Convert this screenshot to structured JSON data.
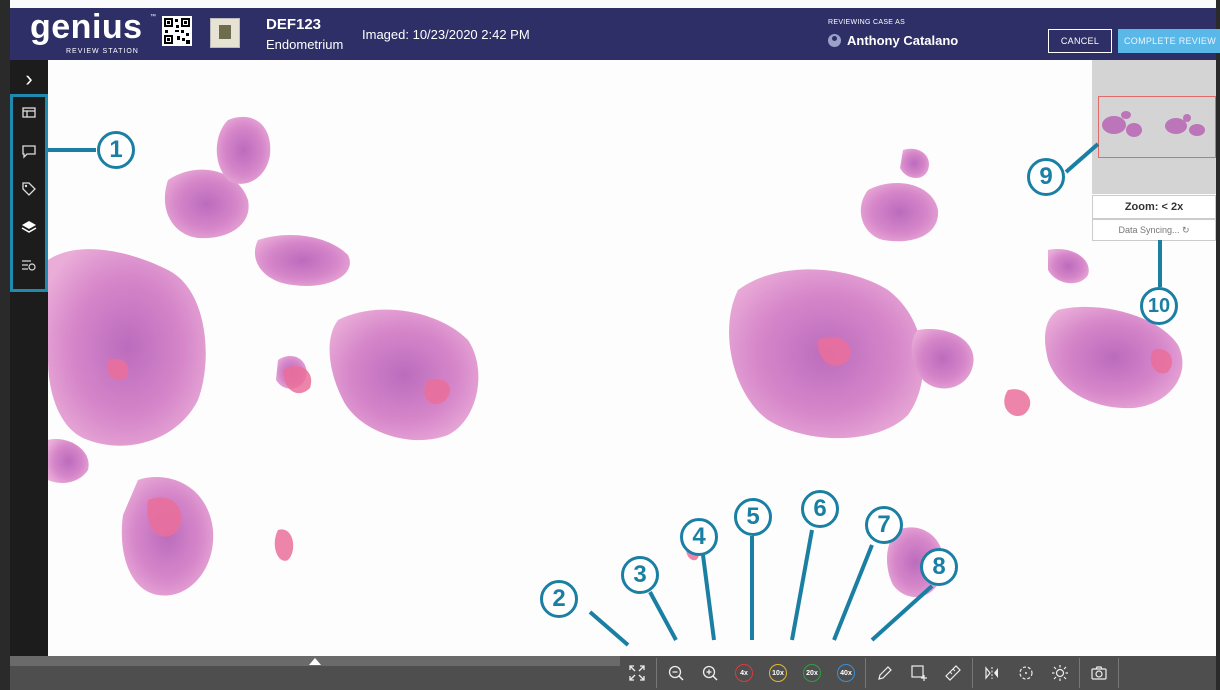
{
  "header": {
    "logo_word": "genius",
    "logo_tm": "™",
    "logo_sub": "REVIEW STATION",
    "case_id": "DEF123",
    "case_type": "Endometrium",
    "imaged": "Imaged: 10/23/2020 2:42 PM",
    "reviewing_label": "REVIEWING CASE AS",
    "reviewer_name": "Anthony Catalano",
    "cancel_label": "CANCEL",
    "complete_label": "COMPLETE REVIEW"
  },
  "sidebar": {
    "toggle_icon": "chevron-right-icon",
    "items": [
      {
        "icon": "slides-icon"
      },
      {
        "icon": "comment-icon"
      },
      {
        "icon": "tag-icon"
      },
      {
        "icon": "layers-icon"
      },
      {
        "icon": "filter-list-icon"
      }
    ]
  },
  "minimap": {
    "zoom_text": "Zoom: < 2x",
    "sync_text": "Data Syncing..."
  },
  "toolbar": {
    "mag_4x": "4x",
    "mag_10x": "10x",
    "mag_20x": "20x",
    "mag_40x": "40x"
  },
  "callouts": [
    "1",
    "2",
    "3",
    "4",
    "5",
    "6",
    "7",
    "8",
    "9",
    "10"
  ],
  "colors": {
    "header_bg": "#2d2f66",
    "accent": "#1a7fa3",
    "complete_btn": "#5ab8e8",
    "tissue": "#c060b0"
  }
}
